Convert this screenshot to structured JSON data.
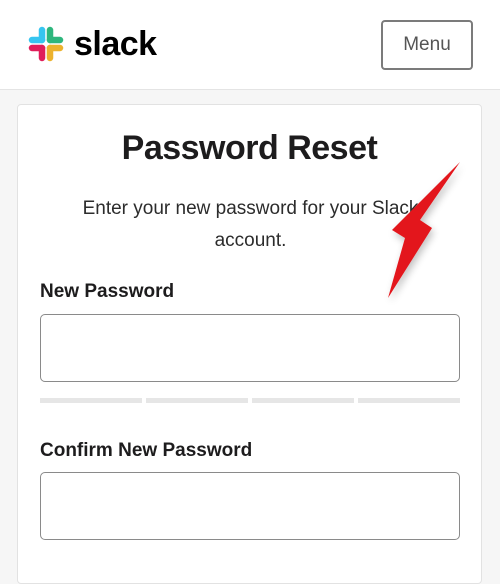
{
  "header": {
    "brand_name": "slack",
    "menu_label": "Menu",
    "logo_colors": [
      "#36C5F0",
      "#2EB67D",
      "#ECB22E",
      "#E01E5A"
    ]
  },
  "form": {
    "title": "Password Reset",
    "subtitle": "Enter your new password for your Slack account.",
    "new_password": {
      "label": "New Password",
      "value": ""
    },
    "confirm_password": {
      "label": "Confirm New Password",
      "value": ""
    },
    "strength_meter": {
      "segments": 4,
      "filled": 0
    }
  },
  "annotation": {
    "icon": "red-pointer-arrow-icon",
    "color": "#e3161c"
  }
}
